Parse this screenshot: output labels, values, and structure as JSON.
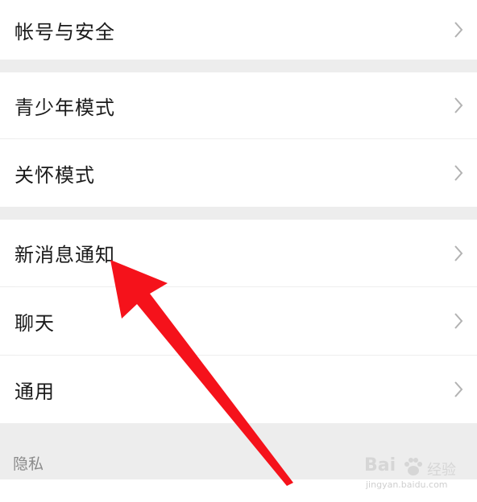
{
  "settings": {
    "groups": [
      [
        {
          "label": "帐号与安全"
        }
      ],
      [
        {
          "label": "青少年模式"
        },
        {
          "label": "关怀模式"
        }
      ],
      [
        {
          "label": "新消息通知"
        },
        {
          "label": "聊天"
        },
        {
          "label": "通用"
        }
      ]
    ],
    "privacy_header": "隐私"
  },
  "annotation": {
    "arrow_color": "#f5121b",
    "target": "新消息通知"
  },
  "watermark": {
    "brand_prefix": "Bai",
    "brand_suffix": "经验",
    "url": "jingyan.baidu.com"
  }
}
